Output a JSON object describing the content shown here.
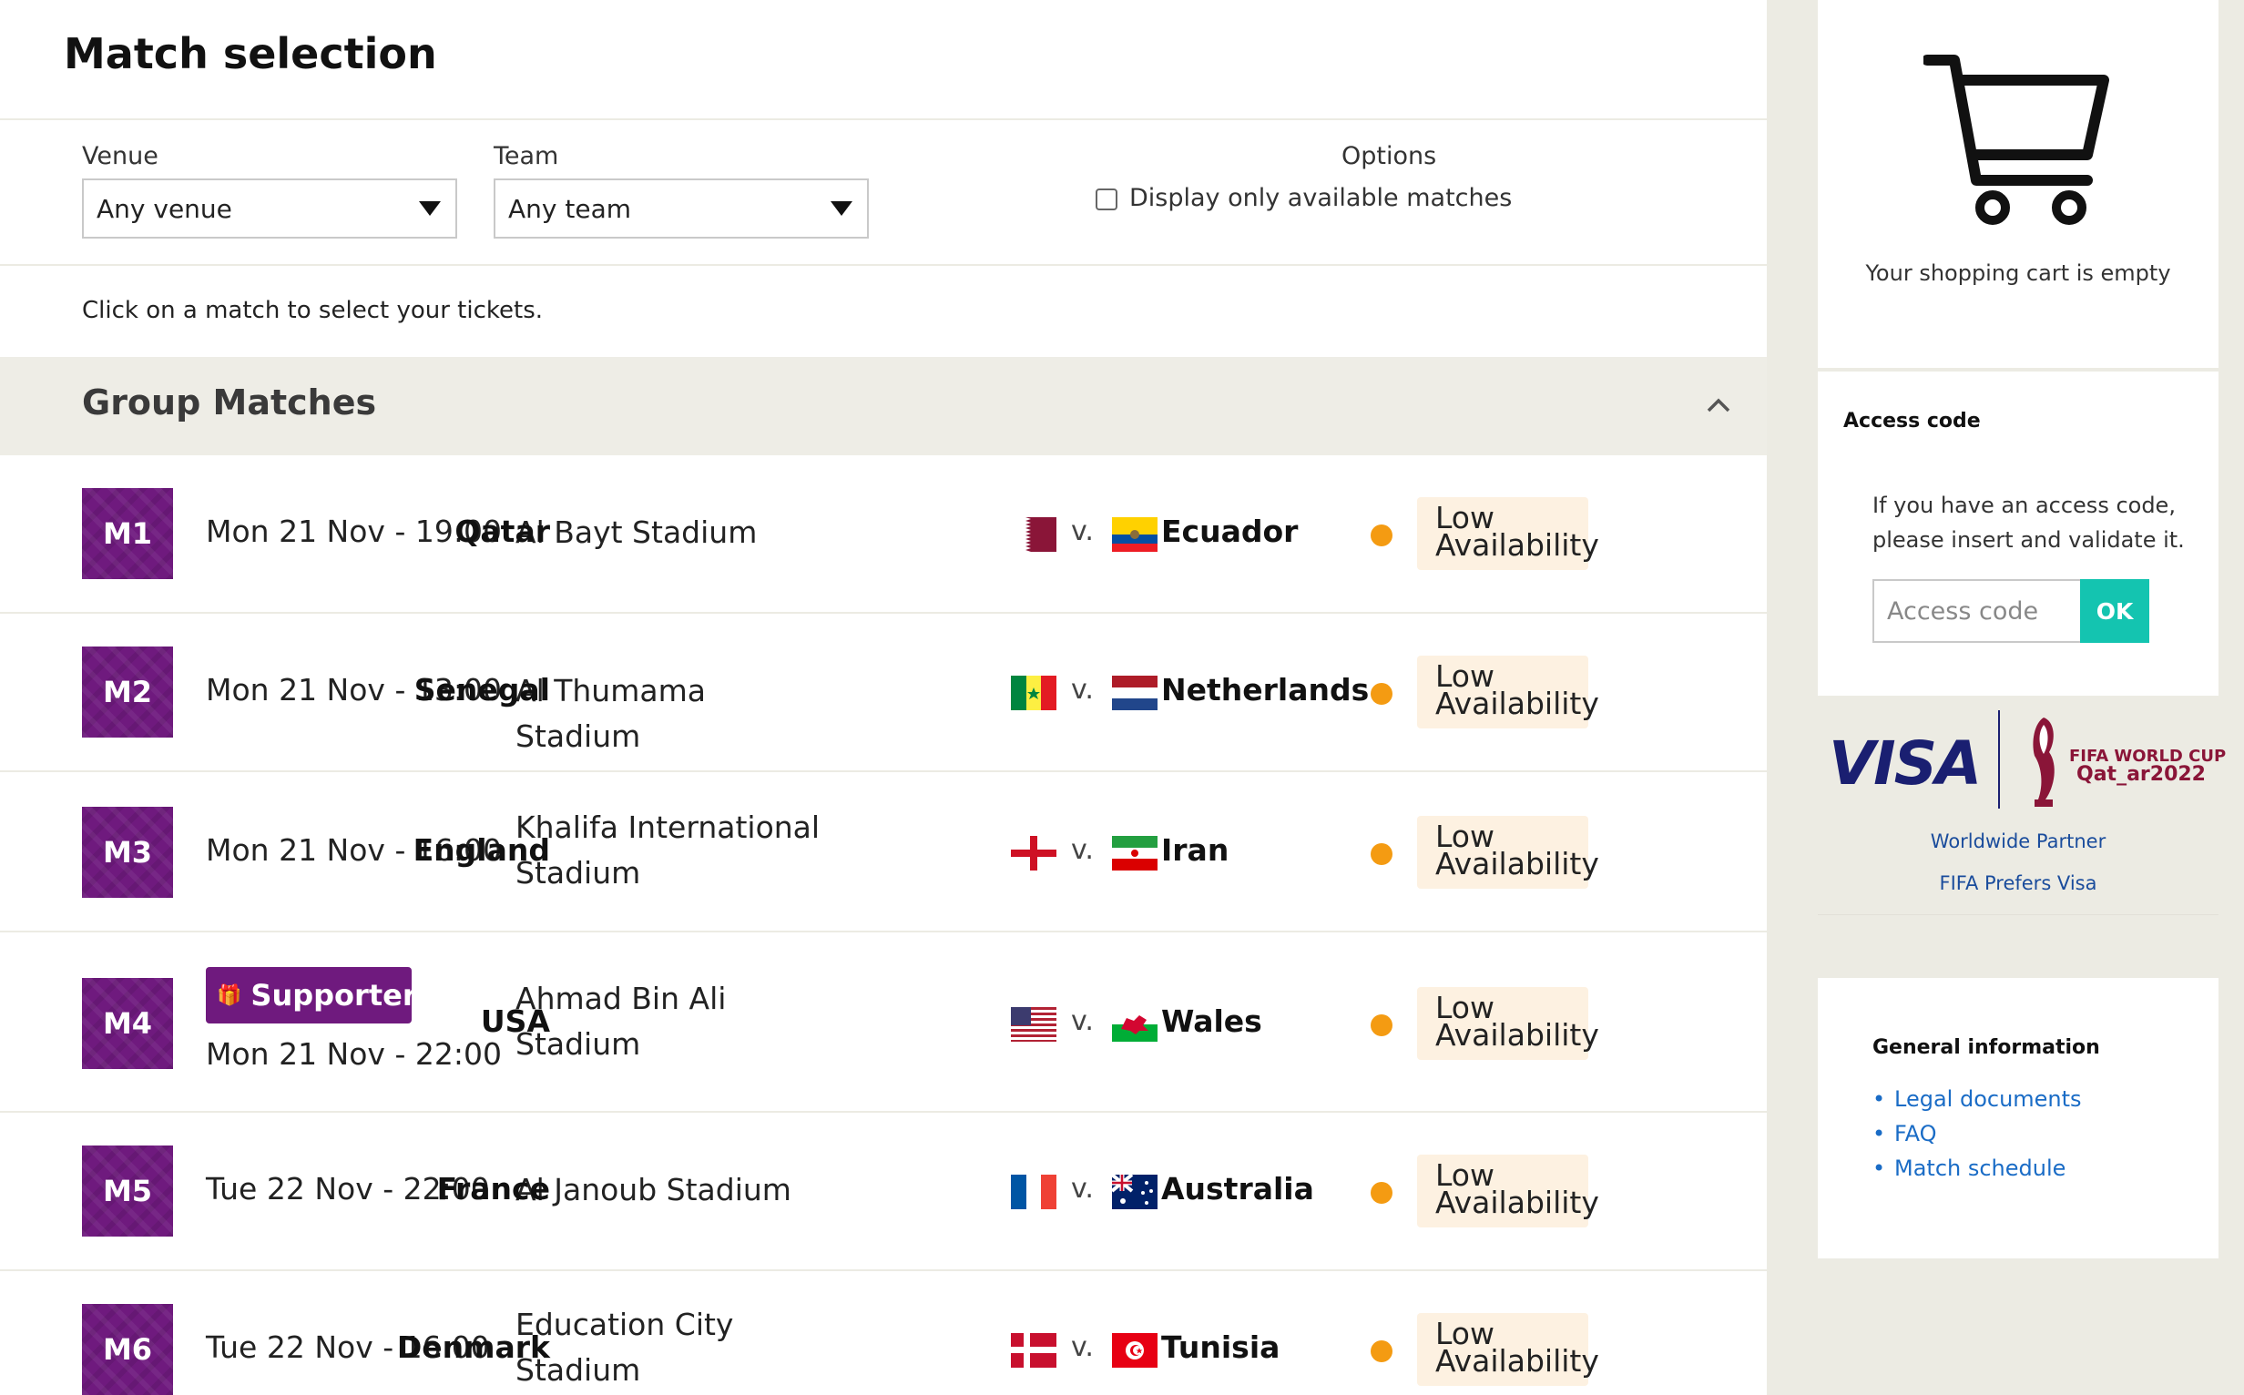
{
  "page": {
    "title": "Match selection"
  },
  "filters": {
    "venue_label": "Venue",
    "venue_value": "Any venue",
    "team_label": "Team",
    "team_value": "Any team",
    "options_label": "Options",
    "available_only_label": "Display only available matches",
    "available_only_checked": false
  },
  "hint": "Click on a match to select your tickets.",
  "group": {
    "title": "Group Matches",
    "matches": [
      {
        "code": "M1",
        "date": "Mon 21 Nov - 19:00",
        "venue": "Al Bayt Stadium",
        "home": "Qatar",
        "home_flag": "qatar-flag-icon",
        "vs": "v.",
        "away": "Ecuador",
        "away_flag": "ecuador-flag-icon",
        "availability": "Low Availability",
        "availability_color": "#f49b12"
      },
      {
        "code": "M2",
        "date": "Mon 21 Nov - 13:00",
        "venue": "Al Thumama Stadium",
        "home": "Senegal",
        "home_flag": "senegal-flag-icon",
        "vs": "v.",
        "away": "Netherlands",
        "away_flag": "netherlands-flag-icon",
        "availability": "Low Availability",
        "availability_color": "#f49b12"
      },
      {
        "code": "M3",
        "date": "Mon 21 Nov - 16:00",
        "venue": "Khalifa International Stadium",
        "home": "England",
        "home_flag": "england-flag-icon",
        "vs": "v.",
        "away": "Iran",
        "away_flag": "iran-flag-icon",
        "availability": "Low Availability",
        "availability_color": "#f49b12"
      },
      {
        "code": "M4",
        "supporters": "Supporters",
        "date": "Mon 21 Nov - 22:00",
        "venue": "Ahmad Bin Ali Stadium",
        "home": "USA",
        "home_flag": "usa-flag-icon",
        "vs": "v.",
        "away": "Wales",
        "away_flag": "wales-flag-icon",
        "availability": "Low Availability",
        "availability_color": "#f49b12"
      },
      {
        "code": "M5",
        "date": "Tue 22 Nov - 22:00",
        "venue": "Al Janoub Stadium",
        "home": "France",
        "home_flag": "france-flag-icon",
        "vs": "v.",
        "away": "Australia",
        "away_flag": "australia-flag-icon",
        "availability": "Low Availability",
        "availability_color": "#f49b12"
      },
      {
        "code": "M6",
        "date": "Tue 22 Nov - 16:00",
        "venue": "Education City Stadium",
        "home": "Denmark",
        "home_flag": "denmark-flag-icon",
        "vs": "v.",
        "away": "Tunisia",
        "away_flag": "tunisia-flag-icon",
        "availability": "Low Availability",
        "availability_color": "#f49b12"
      }
    ]
  },
  "cart": {
    "icon": "shopping-cart-icon",
    "empty_text": "Your shopping cart is empty"
  },
  "access_code": {
    "title": "Access code",
    "description": "If you have an access code, please insert and validate it.",
    "placeholder": "Access code",
    "button": "OK"
  },
  "sponsor": {
    "brand": "VISA",
    "event_line1": "FIFA WORLD CUP",
    "event_line2": "Qat_ar2022",
    "line1": "Worldwide Partner",
    "line2": "FIFA Prefers Visa"
  },
  "general_info": {
    "title": "General information",
    "links": [
      "Legal documents",
      "FAQ",
      "Match schedule"
    ]
  },
  "colors": {
    "brand_purple": "#6f1a7e",
    "accent_teal": "#14c4b0",
    "availability_orange": "#f49b12",
    "link_blue": "#1a6cc6"
  }
}
